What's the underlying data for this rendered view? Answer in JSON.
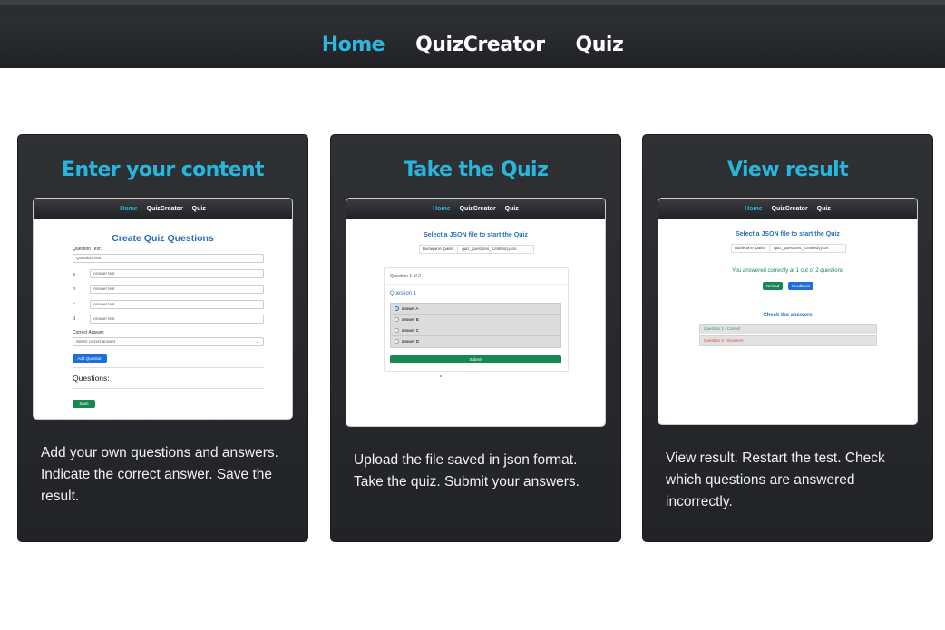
{
  "nav": {
    "home": "Home",
    "creator": "QuizCreator",
    "quiz": "Quiz"
  },
  "colors": {
    "accent": "#27b6dc",
    "card_bg": "#27292d",
    "header_bg": "#2b2d31"
  },
  "cards": [
    {
      "title": "Enter your content",
      "description": "Add your own questions and answers. Indicate the correct answer. Save the result.",
      "shot": {
        "heading": "Create Quiz Questions",
        "question_label": "Question Text:",
        "question_placeholder": "Question Text",
        "answer_letters": [
          "a",
          "b",
          "c",
          "d"
        ],
        "answer_placeholder": "Answer text",
        "correct_label": "Correct Answer:",
        "correct_placeholder": "Select correct answer",
        "add_button": "Add Question",
        "questions_heading": "Questions:",
        "save_button": "Save"
      }
    },
    {
      "title": "Take the Quiz",
      "description": "Upload the file saved in json format. Take the quiz. Submit your answers.",
      "shot": {
        "heading": "Select a JSON file to start the Quiz",
        "file_button": "Выберите файл",
        "file_name": "quiz_questions_(Untitled).json",
        "question_counter": "Question 1 of 2",
        "question_title": "Question 1",
        "options": [
          "answer A",
          "answer B",
          "answer C",
          "answer D"
        ],
        "submit_button": "Submit"
      }
    },
    {
      "title": "View result",
      "description": "View result. Restart the test. Check which questions are answered incorrectly.",
      "shot": {
        "heading": "Select a JSON file to start the Quiz",
        "file_button": "Выберите файл",
        "file_name": "quiz_questions_(Untitled).json",
        "result_text": "You answered correctly at 1 out of 2 questions",
        "reload_button": "Reload",
        "feedback_button": "Feedback",
        "check_heading": "Check the answers",
        "answers": [
          "Question 1 - Correct",
          "Question 2 - Incorrect"
        ]
      }
    }
  ]
}
